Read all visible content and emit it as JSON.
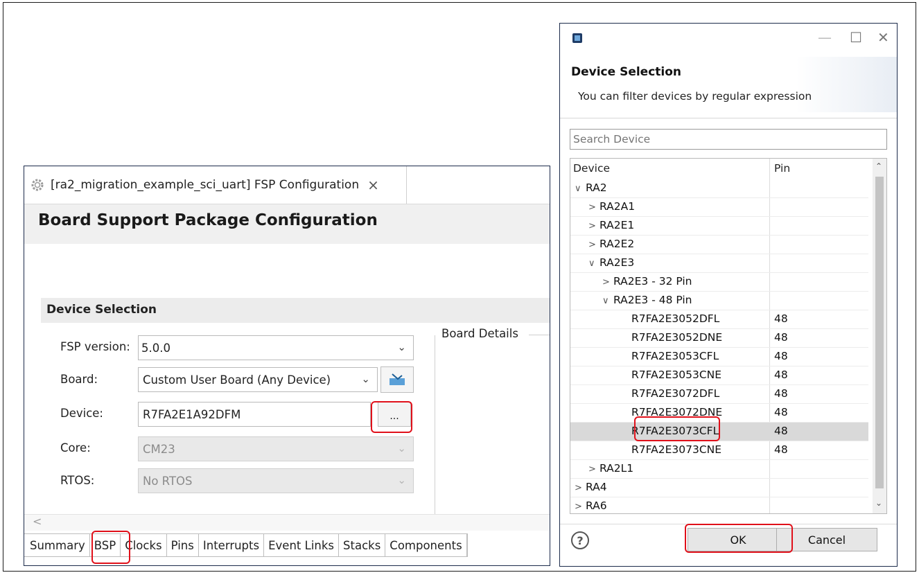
{
  "editor": {
    "tab_title": "[ra2_migration_example_sci_uart] FSP Configuration",
    "tab_close": "×",
    "header_title": "Board Support Package Configuration",
    "section_title": "Device Selection",
    "board_details_label": "Board Details",
    "scroll_left": "<",
    "form": {
      "fsp_version_label": "FSP version:",
      "fsp_version_value": "5.0.0",
      "board_label": "Board:",
      "board_value": "Custom User Board (Any Device)",
      "device_label": "Device:",
      "device_value": "R7FA2E1A92DFM",
      "device_browse": "...",
      "core_label": "Core:",
      "core_value": "CM23",
      "rtos_label": "RTOS:",
      "rtos_value": "No RTOS"
    },
    "bottom_tabs": [
      "Summary",
      "BSP",
      "Clocks",
      "Pins",
      "Interrupts",
      "Event Links",
      "Stacks",
      "Components"
    ],
    "selected_tab": "BSP"
  },
  "dialog": {
    "title": "Device Selection",
    "subtitle": "You can filter devices by regular expression",
    "search_placeholder": "Search Device",
    "columns": [
      "Device",
      "Pin"
    ],
    "rows": [
      {
        "name": "RA2",
        "pin": "",
        "state": "expanded",
        "indent": 0
      },
      {
        "name": "RA2A1",
        "pin": "",
        "state": "collapsed",
        "indent": 1
      },
      {
        "name": "RA2E1",
        "pin": "",
        "state": "collapsed",
        "indent": 1
      },
      {
        "name": "RA2E2",
        "pin": "",
        "state": "collapsed",
        "indent": 1
      },
      {
        "name": "RA2E3",
        "pin": "",
        "state": "expanded",
        "indent": 1
      },
      {
        "name": "RA2E3 - 32 Pin",
        "pin": "",
        "state": "collapsed",
        "indent": 2
      },
      {
        "name": "RA2E3 - 48 Pin",
        "pin": "",
        "state": "expanded",
        "indent": 2
      },
      {
        "name": "R7FA2E3052DFL",
        "pin": "48",
        "state": "leaf",
        "indent": 3
      },
      {
        "name": "R7FA2E3052DNE",
        "pin": "48",
        "state": "leaf",
        "indent": 3
      },
      {
        "name": "R7FA2E3053CFL",
        "pin": "48",
        "state": "leaf",
        "indent": 3
      },
      {
        "name": "R7FA2E3053CNE",
        "pin": "48",
        "state": "leaf",
        "indent": 3
      },
      {
        "name": "R7FA2E3072DFL",
        "pin": "48",
        "state": "leaf",
        "indent": 3
      },
      {
        "name": "R7FA2E3072DNE",
        "pin": "48",
        "state": "leaf",
        "indent": 3
      },
      {
        "name": "R7FA2E3073CFL",
        "pin": "48",
        "state": "leaf",
        "indent": 3,
        "selected": true
      },
      {
        "name": "R7FA2E3073CNE",
        "pin": "48",
        "state": "leaf",
        "indent": 3
      },
      {
        "name": "RA2L1",
        "pin": "",
        "state": "collapsed",
        "indent": 1
      },
      {
        "name": "RA4",
        "pin": "",
        "state": "collapsed",
        "indent": 0
      },
      {
        "name": "RA6",
        "pin": "",
        "state": "collapsed",
        "indent": 0
      }
    ],
    "ok_label": "OK",
    "cancel_label": "Cancel",
    "help": "?",
    "minimize": "—",
    "maximize": "☐",
    "close": "✕"
  },
  "colors": {
    "highlight": "#e0101a",
    "selected_row": "#d9d9d9"
  }
}
